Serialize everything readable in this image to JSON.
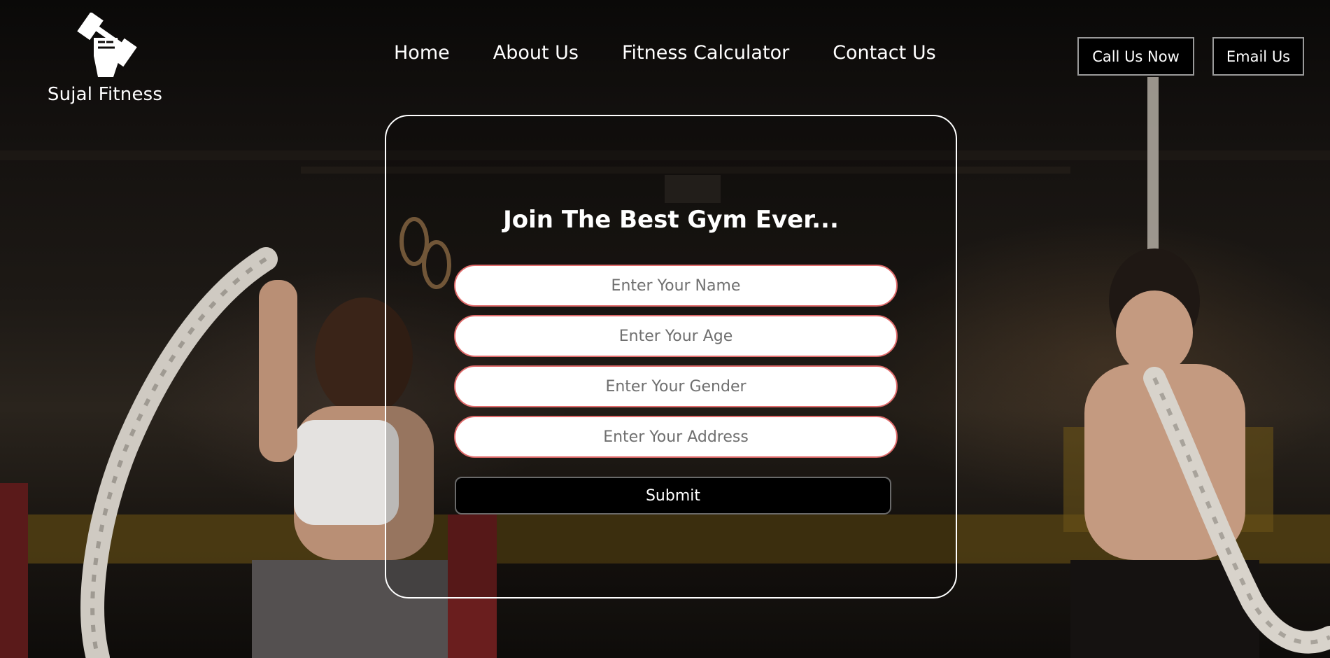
{
  "brand": {
    "name": "Sujal Fitness",
    "logo_icon": "raised-fist-dumbbell-icon"
  },
  "nav": {
    "items": [
      {
        "label": "Home"
      },
      {
        "label": "About Us"
      },
      {
        "label": "Fitness Calculator"
      },
      {
        "label": "Contact Us"
      }
    ]
  },
  "header_actions": {
    "call_label": "Call Us Now",
    "email_label": "Email Us"
  },
  "form": {
    "title": "Join The Best Gym Ever...",
    "fields": [
      {
        "placeholder": "Enter Your Name",
        "value": ""
      },
      {
        "placeholder": "Enter Your Age",
        "value": ""
      },
      {
        "placeholder": "Enter Your Gender",
        "value": ""
      },
      {
        "placeholder": "Enter Your Address",
        "value": ""
      }
    ],
    "submit_label": "Submit"
  },
  "colors": {
    "text": "#ffffff",
    "field_border": "#e06b6b",
    "button_bg": "#000000"
  }
}
